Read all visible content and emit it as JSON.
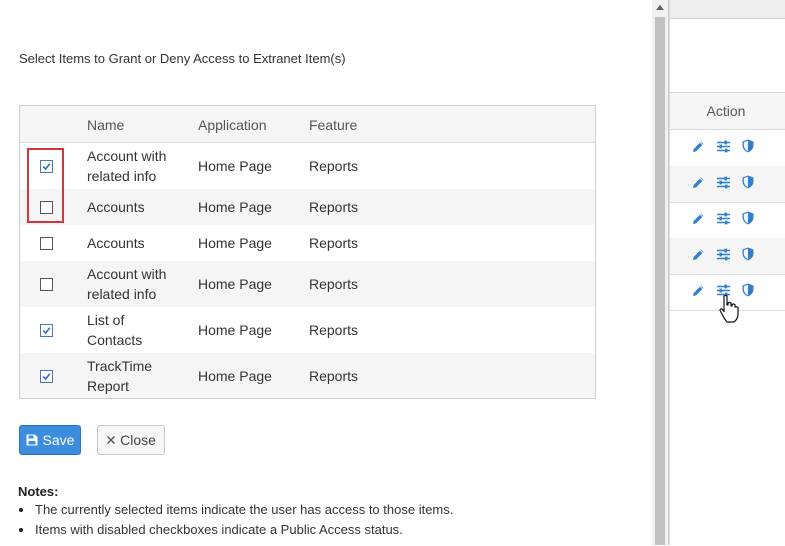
{
  "background_panel": {
    "header": "Action",
    "rows": 5,
    "icons": [
      "pencil-icon",
      "sliders-icon",
      "shield-icon"
    ]
  },
  "modal": {
    "instruction": "Select Items to Grant or Deny Access to Extranet Item(s)",
    "columns": [
      "Name",
      "Application",
      "Feature"
    ],
    "rows": [
      {
        "name": "Account with related info",
        "name_line1": "Account with",
        "name_line2": "related info",
        "application": "Home Page",
        "feature": "Reports",
        "checked": true
      },
      {
        "name": "Accounts",
        "name_line1": "Accounts",
        "name_line2": "",
        "application": "Home Page",
        "feature": "Reports",
        "checked": false
      },
      {
        "name": "Accounts",
        "name_line1": "Accounts",
        "name_line2": "",
        "application": "Home Page",
        "feature": "Reports",
        "checked": false
      },
      {
        "name": "Account with related info",
        "name_line1": "Account with",
        "name_line2": "related info",
        "application": "Home Page",
        "feature": "Reports",
        "checked": false
      },
      {
        "name": "List of Contacts",
        "name_line1": "List of",
        "name_line2": "Contacts",
        "application": "Home Page",
        "feature": "Reports",
        "checked": true
      },
      {
        "name": "TrackTime Report",
        "name_line1": "TrackTime",
        "name_line2": "Report",
        "application": "Home Page",
        "feature": "Reports",
        "checked": true
      }
    ],
    "save_label": "Save",
    "close_label": "Close",
    "notes_title": "Notes:",
    "notes": [
      "The currently selected items indicate the user has access to those items.",
      "Items with disabled checkboxes indicate a Public Access status."
    ]
  },
  "colors": {
    "primary": "#3c8dde",
    "icon_blue": "#2f7fd0",
    "highlight_red": "#d9343b",
    "checkbox_blue": "#4a79b5"
  }
}
